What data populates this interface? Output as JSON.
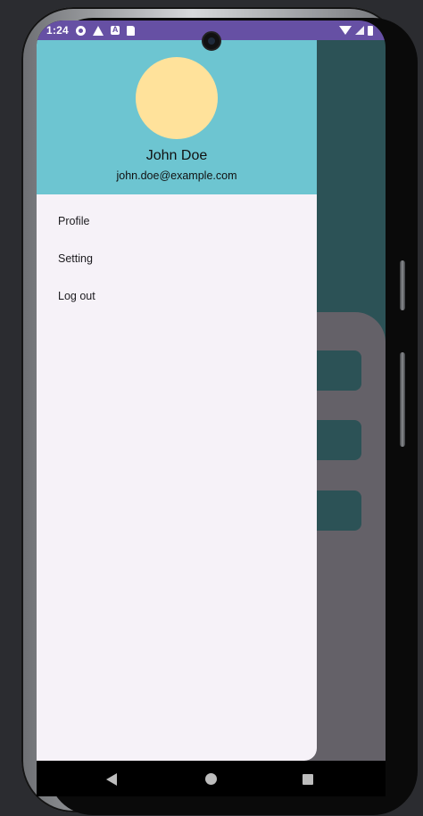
{
  "status_bar": {
    "time": "1:24",
    "left_icons": [
      "gear-icon",
      "warning-icon",
      "a-box-icon",
      "sd-card-icon"
    ],
    "right_icons": [
      "wifi-icon",
      "signal-icon",
      "battery-icon"
    ],
    "color": "#6650a4"
  },
  "drawer": {
    "header_color": "#6dc5d1",
    "avatar_color": "#ffe29b",
    "user_name": "John Doe",
    "user_email": "john.doe@example.com",
    "menu": [
      {
        "label": "Profile"
      },
      {
        "label": "Setting"
      },
      {
        "label": "Log out"
      }
    ]
  },
  "nav_bar": {
    "buttons": [
      "back-icon",
      "home-icon",
      "recents-icon"
    ]
  }
}
